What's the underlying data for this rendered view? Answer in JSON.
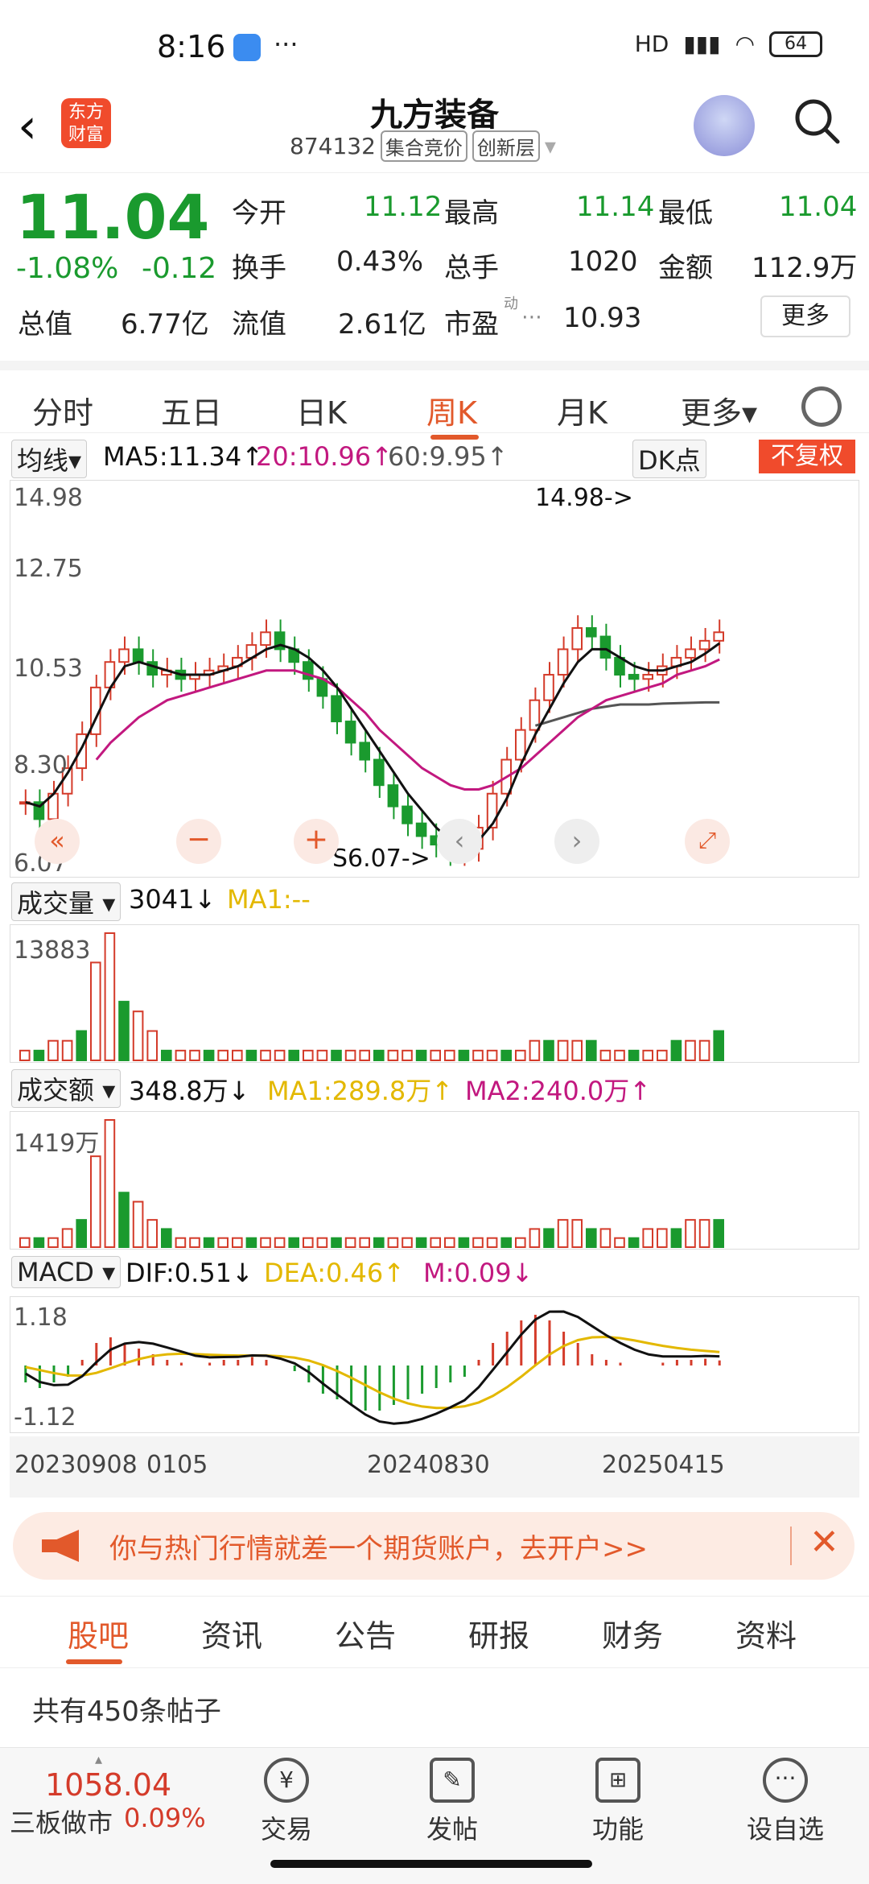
{
  "status": {
    "time": "8:16",
    "dots": "···",
    "network": "HD",
    "battery": "64"
  },
  "header": {
    "back": "‹",
    "logo_line1": "东方",
    "logo_line2": "财富",
    "title": "九方装备",
    "code": "874132",
    "tag1": "集合竞价",
    "tag2": "创新层"
  },
  "quote": {
    "price": "11.04",
    "change_pct": "-1.08%",
    "change": "-0.12",
    "rows": [
      [
        {
          "label": "今开",
          "value": "11.12",
          "tone": "green"
        },
        {
          "label": "最高",
          "value": "11.14",
          "tone": "green"
        },
        {
          "label": "最低",
          "value": "11.04",
          "tone": "green"
        }
      ],
      [
        {
          "label": "换手",
          "value": "0.43%",
          "tone": "plain"
        },
        {
          "label": "总手",
          "value": "1020",
          "tone": "plain"
        },
        {
          "label": "金额",
          "value": "112.9万",
          "tone": "plain"
        }
      ],
      [
        {
          "label": "总值",
          "value": "6.77亿",
          "tone": "plain"
        },
        {
          "label": "流值",
          "value": "2.61亿",
          "tone": "plain"
        },
        {
          "label": "市盈",
          "value": "10.93",
          "tone": "plain"
        }
      ]
    ],
    "pe_sup": "动",
    "more_label": "更多"
  },
  "tabs": [
    "分时",
    "五日",
    "日K",
    "周K",
    "月K",
    "更多▾"
  ],
  "active_tab": "周K",
  "ma_bar": {
    "chip": "均线▾",
    "ma5": "MA5:11.34↑",
    "ma20": "20:10.96↑",
    "ma60": "60:9.95↑",
    "dk": "DK点",
    "fq": "不复权"
  },
  "colors": {
    "up": "#d43b2a",
    "down": "#1a9a2e",
    "ma5": "#111111",
    "ma20": "#c2187f",
    "ma60": "#555555",
    "accent": "#e2592b",
    "dea": "#e3b800"
  },
  "chart_data": [
    {
      "type": "candlestick",
      "ylim": [
        6.07,
        14.98
      ],
      "y_ticks": [
        "14.98",
        "12.75",
        "10.53",
        "8.30",
        "6.07"
      ],
      "annotations": {
        "high": "14.98->",
        "low": "S6.07->"
      },
      "close": [
        7.6,
        7.2,
        7.8,
        8.4,
        9.2,
        10.3,
        10.9,
        11.2,
        10.9,
        10.6,
        10.7,
        10.5,
        10.6,
        10.7,
        10.8,
        11.0,
        11.3,
        11.6,
        11.2,
        10.9,
        10.5,
        10.1,
        9.5,
        9.0,
        8.6,
        8.0,
        7.5,
        7.1,
        6.8,
        6.6,
        6.4,
        6.5,
        7.0,
        7.8,
        8.6,
        9.3,
        10.0,
        10.6,
        11.2,
        11.7,
        11.5,
        11.0,
        10.6,
        10.5,
        10.6,
        10.8,
        11.0,
        11.2,
        11.4,
        11.6
      ],
      "ma5": [
        7.6,
        7.5,
        7.8,
        8.3,
        8.9,
        9.6,
        10.3,
        10.8,
        10.9,
        10.8,
        10.7,
        10.6,
        10.6,
        10.6,
        10.7,
        10.8,
        11.0,
        11.2,
        11.3,
        11.2,
        11.0,
        10.7,
        10.3,
        9.8,
        9.3,
        8.8,
        8.3,
        7.8,
        7.4,
        7.0,
        6.7,
        6.6,
        6.7,
        7.1,
        7.7,
        8.5,
        9.2,
        9.8,
        10.4,
        10.9,
        11.2,
        11.2,
        11.0,
        10.8,
        10.7,
        10.7,
        10.8,
        10.9,
        11.1,
        11.34
      ],
      "ma20": [
        null,
        null,
        null,
        null,
        null,
        8.6,
        9.0,
        9.3,
        9.6,
        9.8,
        10.0,
        10.1,
        10.2,
        10.3,
        10.4,
        10.5,
        10.6,
        10.7,
        10.7,
        10.7,
        10.6,
        10.5,
        10.3,
        10.0,
        9.7,
        9.3,
        9.0,
        8.7,
        8.4,
        8.2,
        8.0,
        7.9,
        7.9,
        8.0,
        8.2,
        8.4,
        8.7,
        9.0,
        9.3,
        9.6,
        9.8,
        10.0,
        10.1,
        10.2,
        10.3,
        10.4,
        10.6,
        10.7,
        10.8,
        10.96
      ],
      "ma60": [
        null,
        null,
        null,
        null,
        null,
        null,
        null,
        null,
        null,
        null,
        null,
        null,
        null,
        null,
        null,
        null,
        null,
        null,
        null,
        null,
        null,
        null,
        null,
        null,
        null,
        null,
        null,
        null,
        null,
        null,
        null,
        null,
        null,
        null,
        null,
        null,
        9.4,
        9.5,
        9.6,
        9.7,
        9.8,
        9.85,
        9.9,
        9.9,
        9.9,
        9.92,
        9.93,
        9.94,
        9.95,
        9.95
      ]
    },
    {
      "type": "bar",
      "title": "成交量",
      "current": "3041↓",
      "ma1": "MA1:--",
      "ymax_label": "13883",
      "values": [
        1,
        1,
        2,
        2,
        3,
        10,
        13,
        6,
        5,
        3,
        1,
        1,
        1,
        1,
        1,
        1,
        1,
        1,
        1,
        1,
        1,
        1,
        1,
        1,
        1,
        1,
        1,
        1,
        1,
        1,
        1,
        1,
        1,
        1,
        1,
        1,
        2,
        2,
        2,
        2,
        2,
        1,
        1,
        1,
        1,
        1,
        2,
        2,
        2,
        3
      ]
    },
    {
      "type": "bar",
      "title": "成交额",
      "current": "348.8万↓",
      "ma1": "MA1:289.8万↑",
      "ma2": "MA2:240.0万↑",
      "ymax_label": "1419万",
      "values": [
        1,
        1,
        1,
        2,
        3,
        10,
        14,
        6,
        5,
        3,
        2,
        1,
        1,
        1,
        1,
        1,
        1,
        1,
        1,
        1,
        1,
        1,
        1,
        1,
        1,
        1,
        1,
        1,
        1,
        1,
        1,
        1,
        1,
        1,
        1,
        1,
        2,
        2,
        3,
        3,
        2,
        2,
        1,
        1,
        2,
        2,
        2,
        3,
        3,
        3
      ]
    },
    {
      "type": "bar",
      "title": "MACD",
      "dif": "DIF:0.51↓",
      "dea": "DEA:0.46↑",
      "m": "M:0.09↓",
      "y_ticks": [
        "1.18",
        "-1.12"
      ],
      "values": [
        -0.3,
        -0.4,
        -0.3,
        -0.2,
        0.1,
        0.4,
        0.5,
        0.4,
        0.3,
        0.2,
        0.1,
        0.05,
        0.0,
        0.05,
        0.1,
        0.1,
        0.15,
        0.1,
        0.0,
        -0.1,
        -0.3,
        -0.5,
        -0.6,
        -0.7,
        -0.8,
        -0.8,
        -0.7,
        -0.6,
        -0.5,
        -0.4,
        -0.3,
        -0.2,
        0.1,
        0.4,
        0.6,
        0.8,
        0.9,
        0.8,
        0.6,
        0.4,
        0.2,
        0.1,
        0.05,
        0.0,
        0.0,
        0.05,
        0.1,
        0.1,
        0.12,
        0.09
      ]
    }
  ],
  "date_axis": [
    "20230908",
    "0105",
    "20240830",
    "20250415"
  ],
  "banner": {
    "text": "你与热门行情就差一个期货账户，去开户>>",
    "close": "✕"
  },
  "bottom_tabs": [
    "股吧",
    "资讯",
    "公告",
    "研报",
    "财务",
    "资料"
  ],
  "posts_count": "共有450条帖子",
  "bottom_nav": {
    "index_value": "1058.04",
    "index_name": "三板做市",
    "index_pct": "0.09%",
    "items": [
      "交易",
      "发帖",
      "功能",
      "设自选"
    ]
  }
}
